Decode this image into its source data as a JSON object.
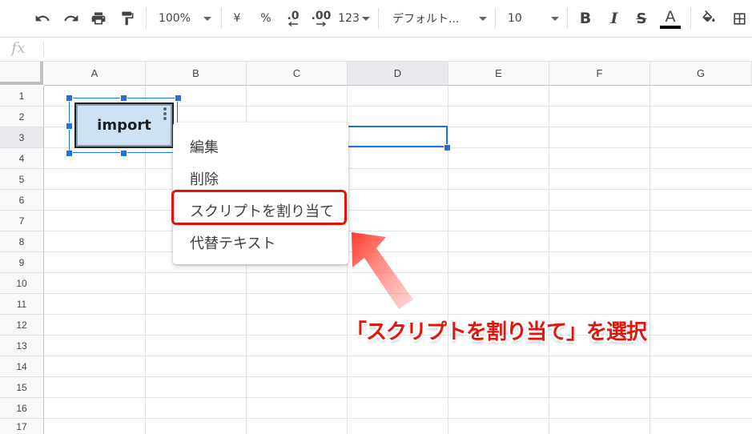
{
  "toolbar": {
    "zoom": "100%",
    "currency": "¥",
    "percent": "%",
    "decrease_decimal": ".0",
    "increase_decimal": ".00",
    "more_formats": "123",
    "font": "デフォルト...",
    "font_size": "10",
    "bold": "B",
    "italic": "I",
    "strikethrough": "S",
    "text_color": "A"
  },
  "formula_bar": {
    "fx": "fx",
    "value": ""
  },
  "columns": [
    "A",
    "B",
    "C",
    "D",
    "E",
    "F",
    "G"
  ],
  "rows": [
    "1",
    "2",
    "3",
    "4",
    "5",
    "6",
    "7",
    "8",
    "9",
    "10",
    "11",
    "12",
    "13",
    "14",
    "15",
    "16",
    "17"
  ],
  "selected_cell": "D3",
  "drawing": {
    "label": "import"
  },
  "context_menu": {
    "items": [
      "編集",
      "削除",
      "スクリプトを割り当て",
      "代替テキスト"
    ],
    "highlighted_index": 2
  },
  "annotation": {
    "text": "「スクリプトを割り当て」を選択"
  },
  "colors": {
    "accent": "#1a73e8",
    "highlight_red": "#e5120c",
    "button_fill": "#cfe2f3"
  }
}
